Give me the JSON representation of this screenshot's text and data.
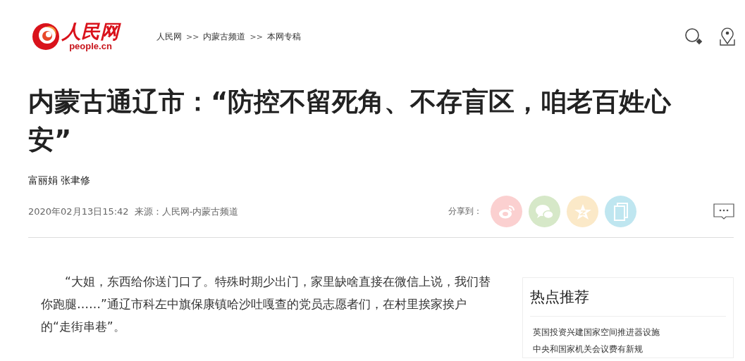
{
  "header": {
    "logo_text": "人民网",
    "logo_domain": "people.cn",
    "breadcrumb": [
      {
        "label": "人民网"
      },
      {
        "label": "内蒙古频道"
      },
      {
        "label": "本网专稿"
      }
    ],
    "breadcrumb_separator": ">>"
  },
  "article": {
    "title": "内蒙古通辽市：“防控不留死角、不存盲区，咱老百姓心安”",
    "authors": "富丽娟 张聿修",
    "date": "2020年02月13日15:42",
    "source": "来源：人民网-内蒙古频道",
    "share_label": "分享到：",
    "share_buttons": [
      {
        "kind": "weibo",
        "color": "#fbd0d0"
      },
      {
        "kind": "wechat",
        "color": "#d6e8c8"
      },
      {
        "kind": "qzone",
        "color": "#fbe9c8"
      },
      {
        "kind": "copy",
        "color": "#bfe6f0"
      }
    ],
    "paragraphs": [
      "“大姐，东西给你送门口了。特殊时期少出门，家里缺啥直接在微信上说，我们替你跑腿……”通辽市科左中旗保康镇哈沙吐嘎查的党员志愿者们，在村里挨家挨户的“走街串巷”。"
    ]
  },
  "sidebar": {
    "title": "热点推荐",
    "items": [
      "英国投资兴建国家空间推进器设施",
      "中央和国家机关会议费有新规"
    ]
  }
}
